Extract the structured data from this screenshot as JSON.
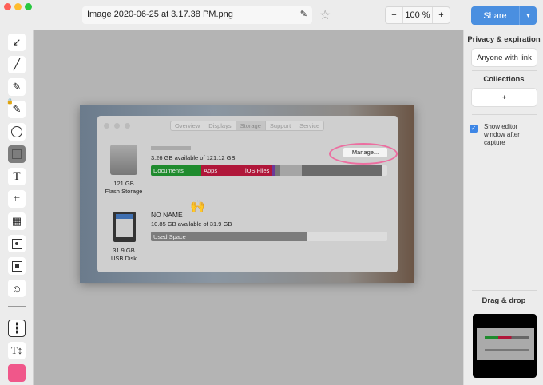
{
  "window": {
    "filename": "Image 2020-06-25 at 3.17.38 PM.png",
    "zoom": "100 %",
    "zoom_minus": "−",
    "zoom_plus": "+",
    "share": "Share",
    "share_arrow": "▾"
  },
  "tools": [
    "arrow-icon",
    "line-icon",
    "marker-icon",
    "highlighter-icon",
    "ellipse-icon",
    "rectangle-icon",
    "text-icon",
    "crop-icon",
    "pixelate-icon",
    "spotlight-icon",
    "highlight-box-icon",
    "emoji-icon"
  ],
  "sidebar": {
    "privacy_title": "Privacy & expiration",
    "privacy_value": "Anyone with link",
    "collections_title": "Collections",
    "collections_add": "+",
    "checkbox_label": "Show editor window after capture",
    "checkbox_checked": true,
    "dragdrop_title": "Drag & drop"
  },
  "colors": {
    "accent": "#4a8fe0",
    "tool_color": "#f0578a"
  },
  "screenshot": {
    "tabs": [
      "Overview",
      "Displays",
      "Storage",
      "Support",
      "Service"
    ],
    "disk1": {
      "available": "3.26 GB available of 121.12 GB",
      "size": "121 GB",
      "type": "Flash Storage",
      "seg_docs": "Documents",
      "seg_apps": "Apps",
      "seg_ios": "iOS Files",
      "manage": "Manage..."
    },
    "disk2": {
      "name": "NO NAME",
      "available": "10.85 GB available of 31.9 GB",
      "size": "31.9 GB",
      "type": "USB Disk",
      "used": "Used Space",
      "used_fraction": 0.66
    },
    "emoji": "🙌"
  }
}
